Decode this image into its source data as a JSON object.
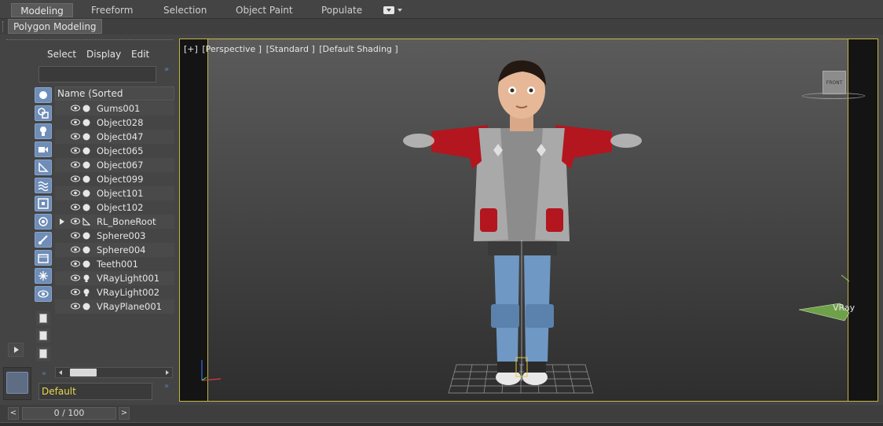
{
  "ribbon": {
    "tabs": [
      {
        "label": "Modeling",
        "active": true
      },
      {
        "label": "Freeform",
        "active": false
      },
      {
        "label": "Selection",
        "active": false
      },
      {
        "label": "Object Paint",
        "active": false
      },
      {
        "label": "Populate",
        "active": false
      }
    ],
    "sub_tab": "Polygon Modeling"
  },
  "explorer": {
    "menu": [
      "Select",
      "Display",
      "Edit"
    ],
    "search_value": "",
    "column_header": "Name (Sorted Ascending)",
    "rows": [
      {
        "name": "Gums001",
        "type": "geometry",
        "expandable": false
      },
      {
        "name": "Object028",
        "type": "geometry",
        "expandable": false
      },
      {
        "name": "Object047",
        "type": "geometry",
        "expandable": false
      },
      {
        "name": "Object065",
        "type": "geometry",
        "expandable": false
      },
      {
        "name": "Object067",
        "type": "geometry",
        "expandable": false
      },
      {
        "name": "Object099",
        "type": "geometry",
        "expandable": false
      },
      {
        "name": "Object101",
        "type": "geometry",
        "expandable": false
      },
      {
        "name": "Object102",
        "type": "geometry",
        "expandable": false
      },
      {
        "name": "RL_BoneRoot",
        "type": "bone",
        "expandable": true
      },
      {
        "name": "Sphere003",
        "type": "geometry",
        "expandable": false
      },
      {
        "name": "Sphere004",
        "type": "geometry",
        "expandable": false
      },
      {
        "name": "Teeth001",
        "type": "geometry",
        "expandable": false
      },
      {
        "name": "VRayLight001",
        "type": "light",
        "expandable": false
      },
      {
        "name": "VRayLight002",
        "type": "light",
        "expandable": false
      },
      {
        "name": "VRayPlane001",
        "type": "geometry",
        "expandable": false
      }
    ],
    "layer": "Default"
  },
  "timeline": {
    "frame_display": "0 / 100",
    "prev_label": "<",
    "next_label": ">"
  },
  "viewport": {
    "label_parts": [
      "[+]",
      "[Perspective ]",
      "[Standard ]",
      "[Default Shading ]"
    ],
    "viewcube_label": "FRONT",
    "vray_text": "VRay"
  },
  "colors": {
    "accent_blue": "#6e8db8",
    "viewport_frame": "#c7b547",
    "layer_text": "#e8d84a",
    "jacket_red": "#b3161f"
  }
}
